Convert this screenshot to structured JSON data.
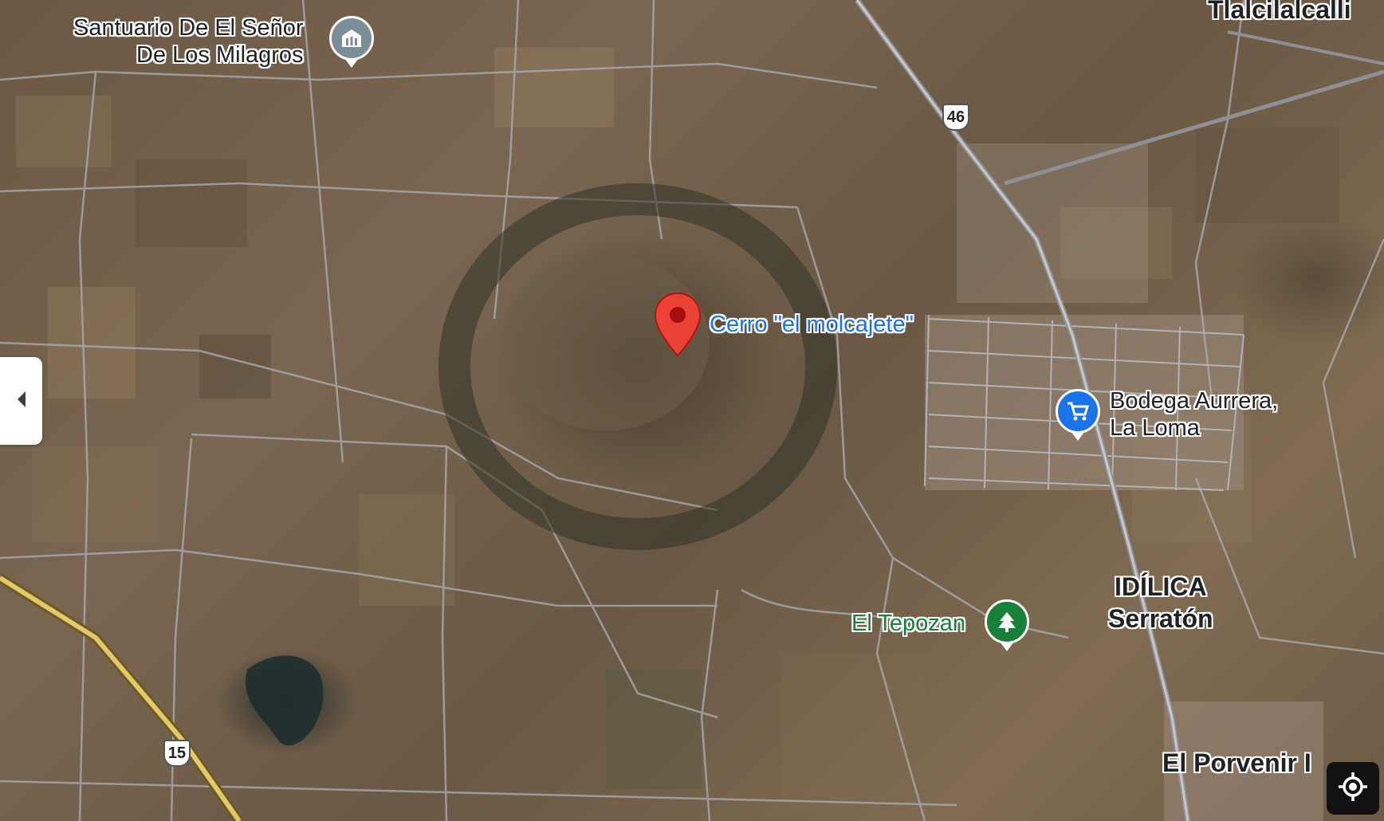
{
  "map": {
    "view": "satellite",
    "pin": {
      "label": "Cerro \"el molcajete\"",
      "color": "#ea4335"
    },
    "places": [
      {
        "name": "Santuario De El Señor\nDe Los Milagros",
        "icon": "church-icon",
        "color": "#7b8d97"
      },
      {
        "name": "Bodega Aurrera,\nLa Loma",
        "icon": "shopping-cart-icon",
        "color": "#1a73e8"
      },
      {
        "name": "El Tepozan",
        "icon": "tree-icon",
        "color": "#188038"
      }
    ],
    "localities": [
      "Tlalcilalcalli",
      "IDÍLICA\nSerratón",
      "El Porvenir I"
    ],
    "routes": [
      "46",
      "15"
    ]
  },
  "controls": {
    "collapse_icon": "chevron-left-icon",
    "locate_icon": "my-location-icon"
  }
}
